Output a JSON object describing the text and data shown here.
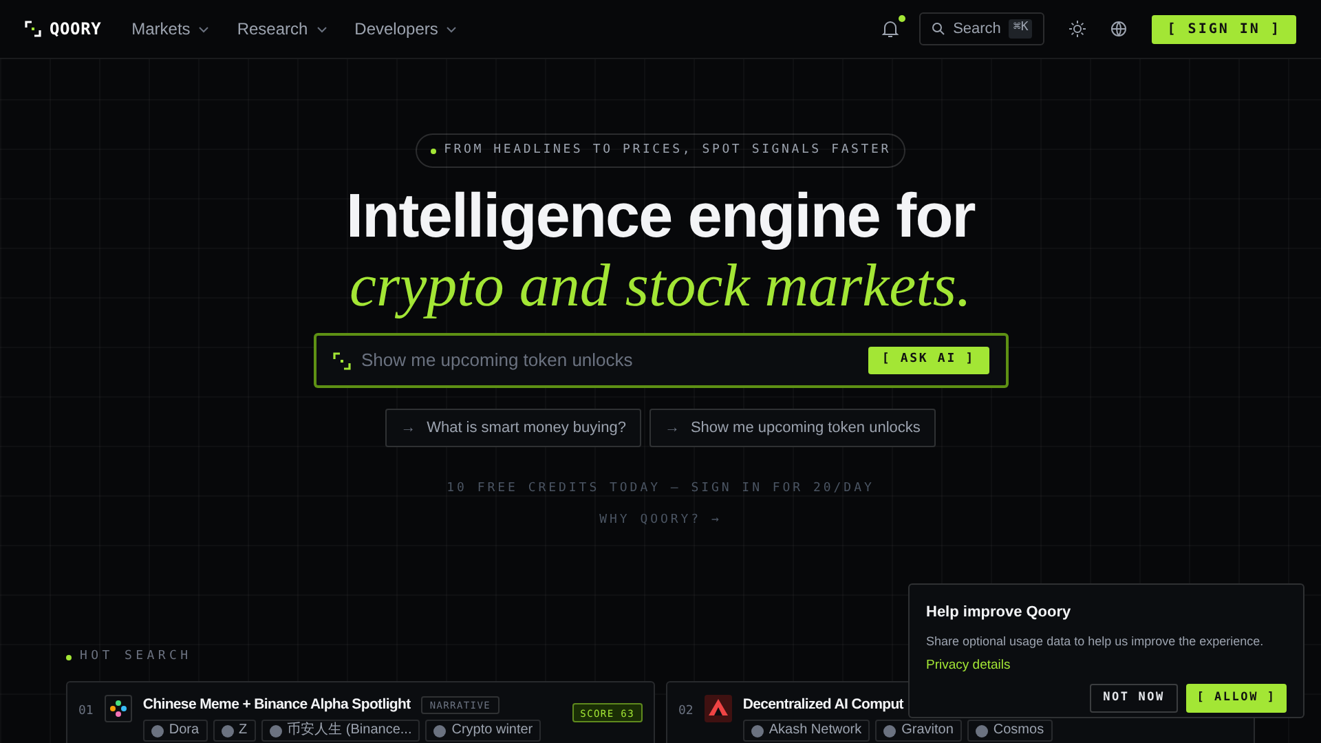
{
  "nav": {
    "logo": "QOORY",
    "menus": [
      {
        "label": "Markets"
      },
      {
        "label": "Research"
      },
      {
        "label": "Developers"
      }
    ],
    "notification_dot": true,
    "search": {
      "label": "Search",
      "shortcut": "⌘K"
    },
    "sign_in": "[ SIGN IN ]"
  },
  "hero": {
    "badge": "FROM HEADLINES TO PRICES, SPOT SIGNALS FASTER",
    "title_line1": "Intelligence engine for",
    "title_line2": "crypto and stock markets.",
    "prompt": {
      "placeholder": "Show me upcoming token unlocks",
      "button": "[ ASK AI ]"
    },
    "suggestions": [
      {
        "arrow": "→",
        "label": "What is smart money buying?"
      },
      {
        "arrow": "→",
        "label": "Show me upcoming token unlocks"
      }
    ],
    "credits": "10 FREE CREDITS TODAY — SIGN IN FOR 20/DAY",
    "why_link": "WHY QOORY? →"
  },
  "hot_search": {
    "title": "HOT SEARCH",
    "cards": [
      {
        "rank": "01",
        "title": "Chinese Meme + Binance Alpha Spotlight",
        "tag": "NARRATIVE",
        "score": "SCORE 63",
        "chips": [
          "Dora",
          "Z",
          "币安人生 (Binance...",
          "Crypto winter"
        ]
      },
      {
        "rank": "02",
        "title": "Decentralized AI Comput",
        "chips": [
          "Akash Network",
          "Graviton",
          "Cosmos"
        ]
      }
    ]
  },
  "consent": {
    "title": "Help improve Qoory",
    "text": "Share optional usage data to help us improve the experience.",
    "link": "Privacy details",
    "buttons": [
      {
        "label": "NOT NOW",
        "kind": "secondary"
      },
      {
        "label": "[ ALLOW ]",
        "kind": "primary"
      }
    ]
  }
}
